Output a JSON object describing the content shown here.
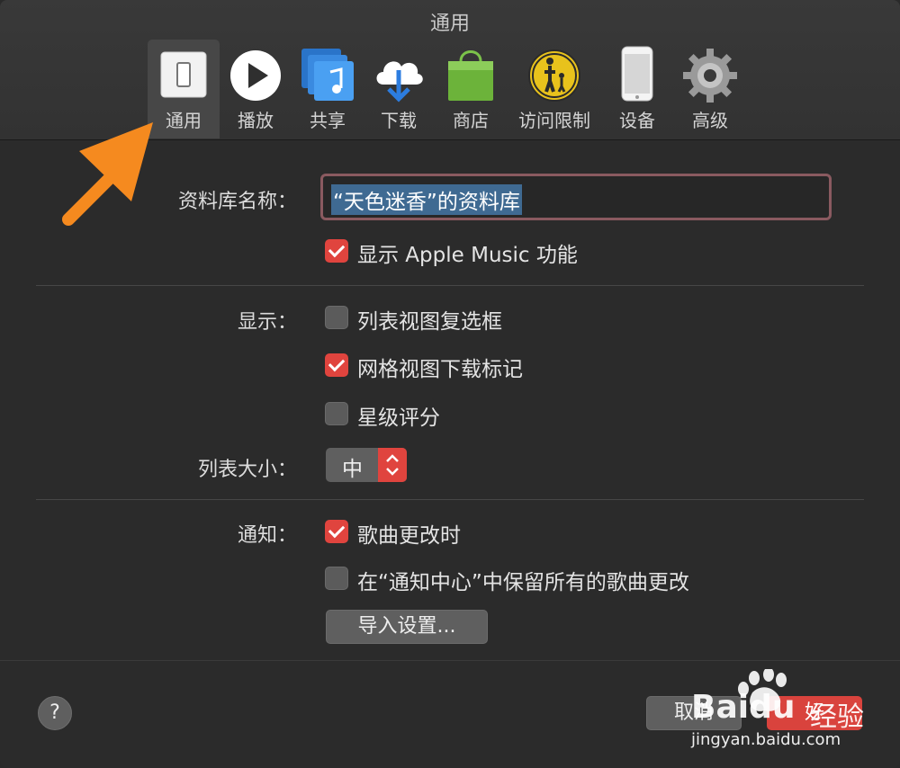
{
  "window": {
    "title": "通用"
  },
  "toolbar": {
    "items": [
      {
        "label": "通用",
        "icon": "toggle-switch-icon",
        "selected": true
      },
      {
        "label": "播放",
        "icon": "play-icon"
      },
      {
        "label": "共享",
        "icon": "shared-music-icon"
      },
      {
        "label": "下载",
        "icon": "cloud-download-icon"
      },
      {
        "label": "商店",
        "icon": "shopping-bag-icon"
      },
      {
        "label": "访问限制",
        "icon": "parental-control-icon"
      },
      {
        "label": "设备",
        "icon": "iphone-icon"
      },
      {
        "label": "高级",
        "icon": "gear-icon"
      }
    ]
  },
  "library": {
    "label": "资料库名称：",
    "value": "“天色迷香”的资料库",
    "apple_music": {
      "label": "显示 Apple Music 功能",
      "checked": true
    }
  },
  "display": {
    "label": "显示：",
    "options": [
      {
        "label": "列表视图复选框",
        "checked": false
      },
      {
        "label": "网格视图下载标记",
        "checked": true
      },
      {
        "label": "星级评分",
        "checked": false
      }
    ]
  },
  "list_size": {
    "label": "列表大小：",
    "value": "中"
  },
  "notify": {
    "label": "通知：",
    "options": [
      {
        "label": "歌曲更改时",
        "checked": true
      },
      {
        "label": "在“通知中心”中保留所有的歌曲更改",
        "checked": false
      }
    ]
  },
  "import_settings": {
    "label": "导入设置..."
  },
  "footer": {
    "help": "?",
    "cancel": "取消",
    "ok": "好"
  },
  "watermark": {
    "brand": "Baidu",
    "brand_cn": "经验",
    "url": "jingyan.baidu.com"
  },
  "colors": {
    "accent": "#e0443e",
    "annotation_arrow": "#f58a1f",
    "selection": "#3f6a92"
  }
}
